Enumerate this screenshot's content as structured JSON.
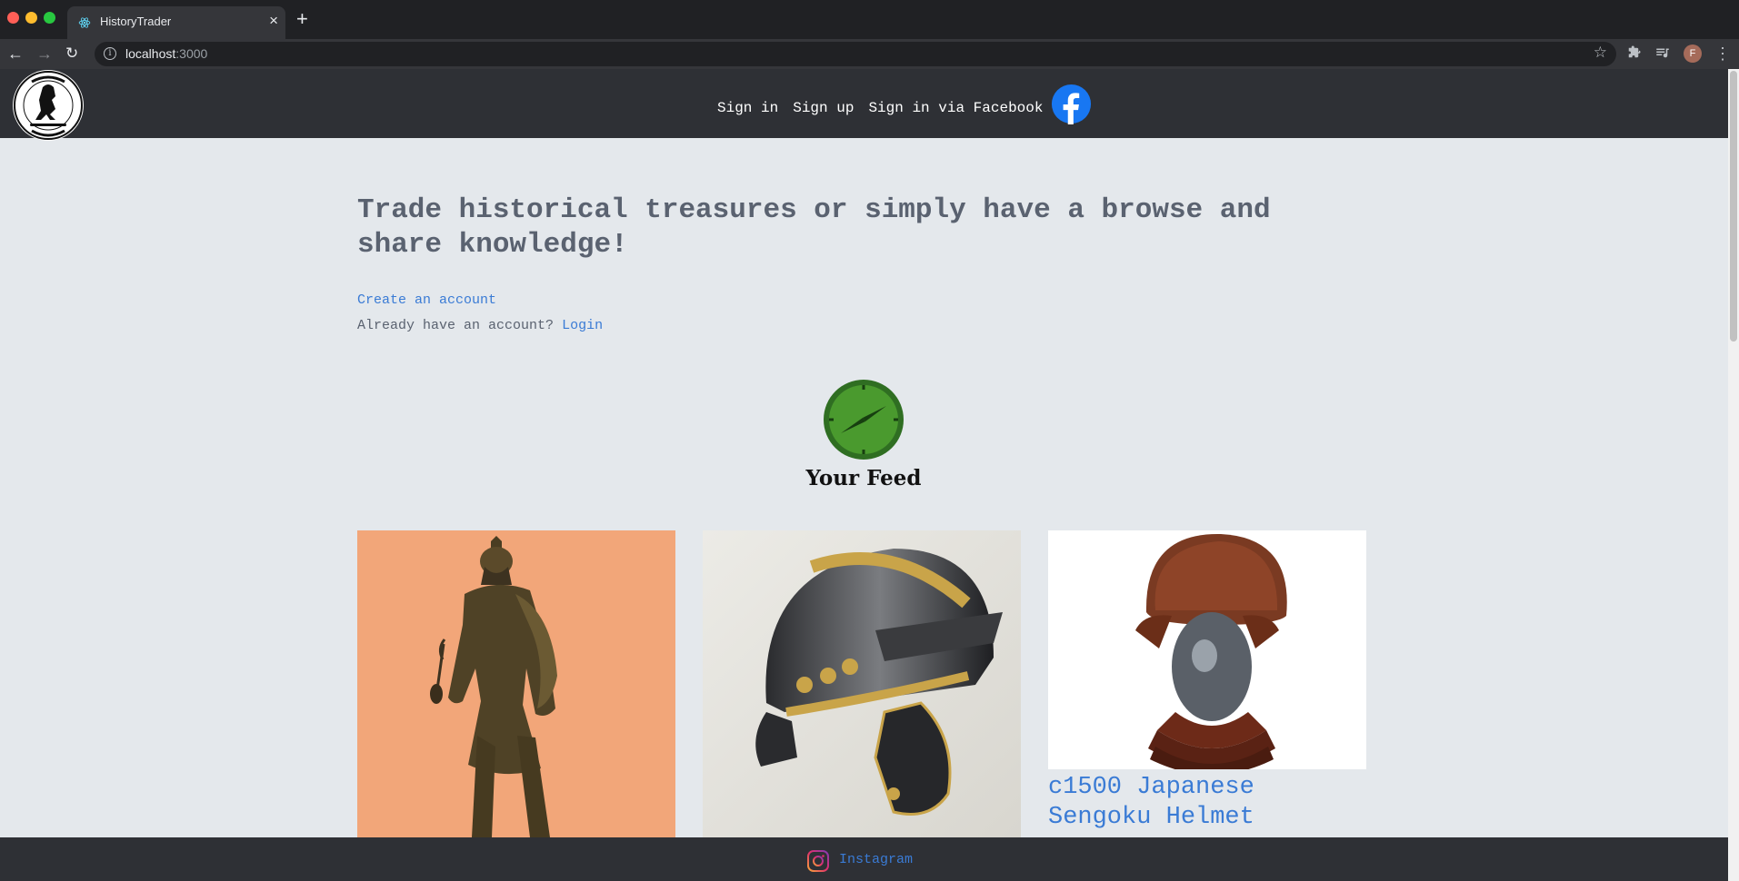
{
  "browser": {
    "tab_title": "HistoryTrader",
    "tab_close": "×",
    "new_tab": "+",
    "url_host": "localhost",
    "url_port": ":3000",
    "avatar_initial": "F"
  },
  "nav": {
    "logo_icon": "history-trader-logo",
    "links": [
      {
        "label": "Sign in"
      },
      {
        "label": "Sign up"
      },
      {
        "label": "Sign in via Facebook"
      }
    ],
    "facebook_icon": "facebook-icon"
  },
  "hero": {
    "headline": "Trade historical treasures or simply have a browse and share knowledge!",
    "create_account": "Create an account",
    "already_text": "Already have an account?",
    "login": "Login"
  },
  "feed": {
    "title": "Your Feed",
    "icon": "compass-icon",
    "cards": [
      {
        "title": "",
        "image": "bronze-warrior-statue"
      },
      {
        "title": "",
        "image": "roman-helmet"
      },
      {
        "title": "c1500 Japanese Sengoku Helmet",
        "image": "japanese-helmet"
      }
    ]
  },
  "footer": {
    "instagram": "Instagram"
  },
  "colors": {
    "page_bg": "#e4e8ec",
    "nav_bg": "#2e3035",
    "link": "#3a7bd5",
    "text": "#5a6270",
    "compass_green": "#3e8e2a"
  }
}
